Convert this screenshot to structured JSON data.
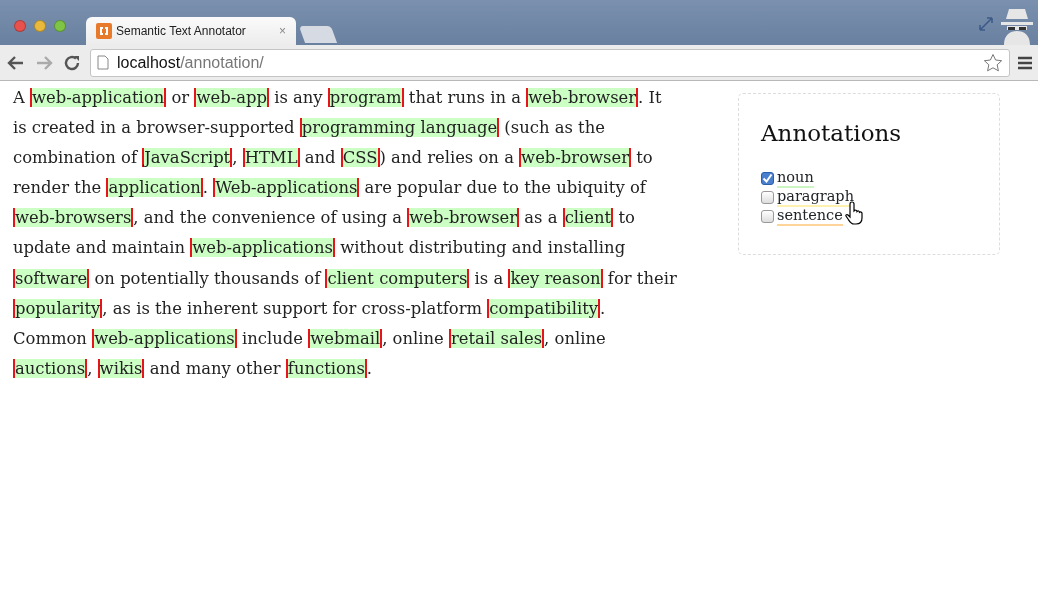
{
  "window": {
    "tab_title": "Semantic Text Annotator",
    "tab_close": "×"
  },
  "address_bar": {
    "host": "localhost",
    "path": "/annotation/"
  },
  "article": [
    {
      "kind": "plain",
      "text": "A "
    },
    {
      "kind": "noun",
      "text": "web-application"
    },
    {
      "kind": "plain",
      "text": " or "
    },
    {
      "kind": "noun",
      "text": "web-app"
    },
    {
      "kind": "plain",
      "text": " is any "
    },
    {
      "kind": "noun",
      "text": "program"
    },
    {
      "kind": "plain",
      "text": " that runs in a "
    },
    {
      "kind": "noun",
      "text": "web-browser"
    },
    {
      "kind": "plain",
      "text": ". It is created in a browser-supported "
    },
    {
      "kind": "noun",
      "text": "programming language"
    },
    {
      "kind": "plain",
      "text": " (such as the combination of "
    },
    {
      "kind": "noun",
      "text": "JavaScript"
    },
    {
      "kind": "plain",
      "text": ", "
    },
    {
      "kind": "noun",
      "text": "HTML"
    },
    {
      "kind": "plain",
      "text": " and "
    },
    {
      "kind": "noun",
      "text": "CSS"
    },
    {
      "kind": "plain",
      "text": ") and relies on a "
    },
    {
      "kind": "noun",
      "text": "web-browser"
    },
    {
      "kind": "plain",
      "text": " to render the "
    },
    {
      "kind": "noun",
      "text": "application"
    },
    {
      "kind": "plain",
      "text": ". "
    },
    {
      "kind": "noun",
      "text": "Web-applications"
    },
    {
      "kind": "plain",
      "text": " are popular due to the ubiquity of "
    },
    {
      "kind": "noun",
      "text": "web-browsers"
    },
    {
      "kind": "plain",
      "text": ", and the convenience of using a "
    },
    {
      "kind": "noun",
      "text": "web-browser"
    },
    {
      "kind": "plain",
      "text": " as a "
    },
    {
      "kind": "noun",
      "text": "client"
    },
    {
      "kind": "plain",
      "text": " to update and maintain "
    },
    {
      "kind": "noun",
      "text": "web-applications"
    },
    {
      "kind": "plain",
      "text": " without distributing and installing "
    },
    {
      "kind": "noun",
      "text": "software"
    },
    {
      "kind": "plain",
      "text": " on potentially thousands of "
    },
    {
      "kind": "noun",
      "text": "client computers"
    },
    {
      "kind": "plain",
      "text": " is a "
    },
    {
      "kind": "noun",
      "text": "key reason"
    },
    {
      "kind": "plain",
      "text": " for their "
    },
    {
      "kind": "noun",
      "text": "popularity"
    },
    {
      "kind": "plain",
      "text": ", as is the inherent support for cross-platform "
    },
    {
      "kind": "noun",
      "text": "compatibility"
    },
    {
      "kind": "plain",
      "text": ". Common "
    },
    {
      "kind": "noun",
      "text": "web-applications"
    },
    {
      "kind": "plain",
      "text": " include "
    },
    {
      "kind": "noun",
      "text": "webmail"
    },
    {
      "kind": "plain",
      "text": ", online "
    },
    {
      "kind": "noun",
      "text": "retail sales"
    },
    {
      "kind": "plain",
      "text": ", online "
    },
    {
      "kind": "noun",
      "text": "auctions"
    },
    {
      "kind": "plain",
      "text": ", "
    },
    {
      "kind": "noun",
      "text": "wikis"
    },
    {
      "kind": "plain",
      "text": " and many other "
    },
    {
      "kind": "noun",
      "text": "functions"
    },
    {
      "kind": "plain",
      "text": "."
    }
  ],
  "annotations": {
    "title": "Annotations",
    "items": [
      {
        "label": "noun",
        "checked": true,
        "color": "#ccf5c4"
      },
      {
        "label": "paragraph",
        "checked": false,
        "color": "#fff2b0"
      },
      {
        "label": "sentence",
        "checked": false,
        "color": "#ffd49a"
      }
    ]
  }
}
